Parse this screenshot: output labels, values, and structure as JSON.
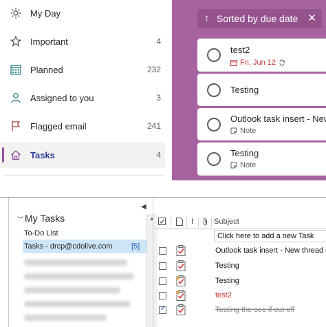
{
  "todo_nav": {
    "items": [
      {
        "label": "My Day",
        "count": "",
        "icon": "sun-icon"
      },
      {
        "label": "Important",
        "count": "4",
        "icon": "star-icon"
      },
      {
        "label": "Planned",
        "count": "232",
        "icon": "calendar-grid-icon"
      },
      {
        "label": "Assigned to you",
        "count": "3",
        "icon": "person-icon"
      },
      {
        "label": "Flagged email",
        "count": "241",
        "icon": "flag-icon"
      },
      {
        "label": "Tasks",
        "count": "4",
        "icon": "home-icon"
      }
    ],
    "active_index": 5
  },
  "tasks_panel": {
    "sort_label": "Sorted by due date",
    "sort_arrow": "↑",
    "close_glyph": "✕",
    "cards": [
      {
        "title": "test2",
        "meta": "Fri, Jun 12",
        "meta_type": "due"
      },
      {
        "title": "Testing",
        "meta": "",
        "meta_type": ""
      },
      {
        "title": "Outlook task insert - New",
        "meta": "Note",
        "meta_type": "note"
      },
      {
        "title": "Testing",
        "meta": "Note",
        "meta_type": "note"
      }
    ]
  },
  "outlook": {
    "folder_header": "My Tasks",
    "folders": [
      {
        "label": "To-Do List",
        "count": ""
      },
      {
        "label": "Tasks - drcp@cdolive.com",
        "count": "[5]"
      }
    ],
    "columns": {
      "subject": "Subject",
      "importance": "!"
    },
    "new_task_placeholder": "Click here to add a new Task",
    "rows": [
      {
        "subject": "Outlook task insert - New thread in",
        "state": "normal",
        "checked": false
      },
      {
        "subject": "Testing",
        "state": "normal",
        "checked": false
      },
      {
        "subject": "Testing",
        "state": "normal",
        "checked": false
      },
      {
        "subject": "test2",
        "state": "overdue",
        "checked": false
      },
      {
        "subject": "Testing the see if cut off",
        "state": "done",
        "checked": true
      }
    ]
  },
  "colors": {
    "accent_purple": "#a7639f",
    "nav_active_text": "#2c3e9e",
    "overdue_red": "#d42b2b",
    "selection_blue": "#cde6f7"
  }
}
